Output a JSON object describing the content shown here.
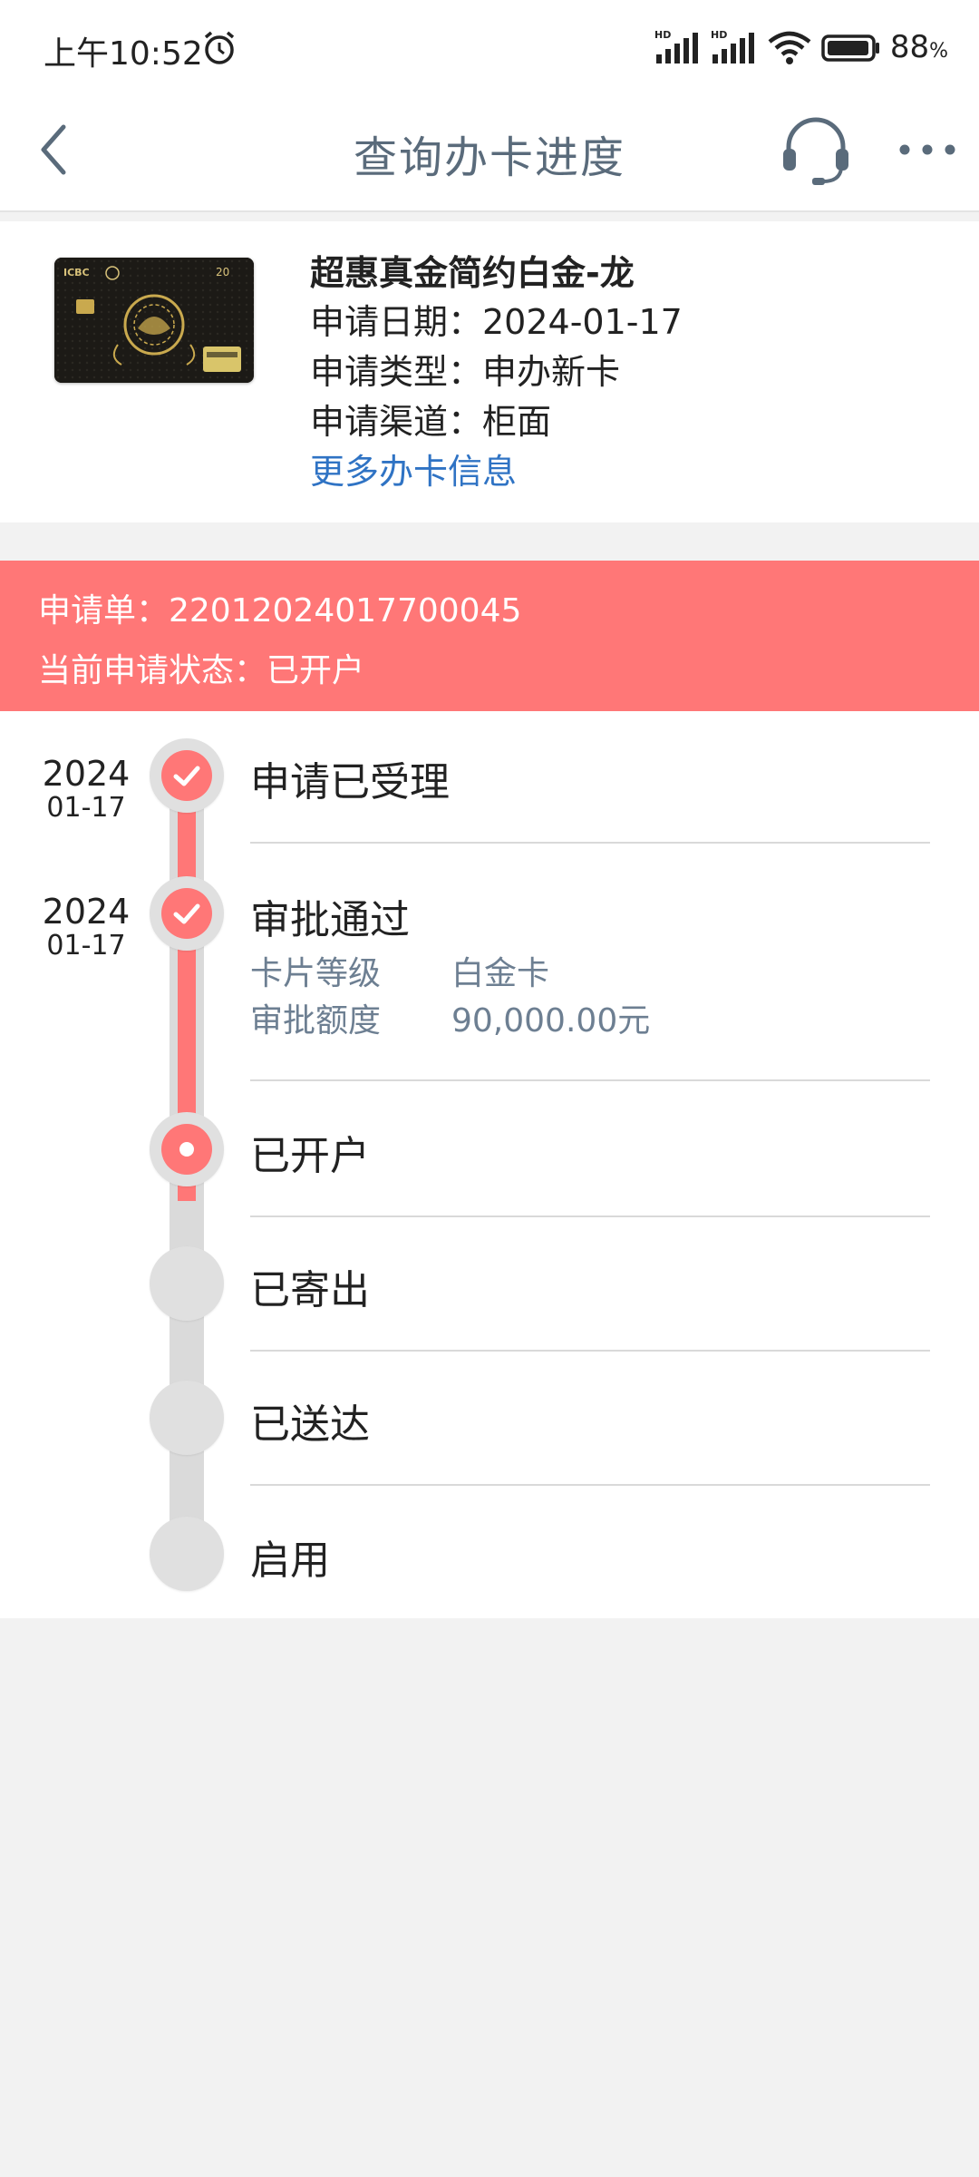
{
  "status_bar": {
    "time": "上午10:52",
    "battery_percent": "88",
    "battery_unit": "%"
  },
  "nav": {
    "title": "查询办卡进度"
  },
  "card": {
    "name": "超惠真金简约白金-龙",
    "apply_date": "申请日期：2024-01-17",
    "apply_type": "申请类型：申办新卡",
    "apply_channel": "申请渠道：柜面",
    "more_link": "更多办卡信息",
    "image_brand": "ICBC"
  },
  "banner": {
    "application_no": "申请单：22012024017700045",
    "current_status": "当前申请状态：已开户",
    "color": "#ff7777"
  },
  "steps": [
    {
      "label": "申请已受理",
      "year": "2024",
      "date": "01-17",
      "state": "done"
    },
    {
      "label": "审批通过",
      "year": "2024",
      "date": "01-17",
      "state": "done",
      "details": [
        {
          "key": "卡片等级",
          "value": "白金卡"
        },
        {
          "key": "审批额度",
          "value": "90,000.00元"
        }
      ]
    },
    {
      "label": "已开户",
      "state": "current"
    },
    {
      "label": "已寄出",
      "state": "pending"
    },
    {
      "label": "已送达",
      "state": "pending"
    },
    {
      "label": "启用",
      "state": "pending"
    }
  ],
  "colors": {
    "accent": "#ff7777",
    "link": "#2f73c4",
    "title_gray": "#5a6b7b",
    "detail_gray": "#6d7f92"
  }
}
